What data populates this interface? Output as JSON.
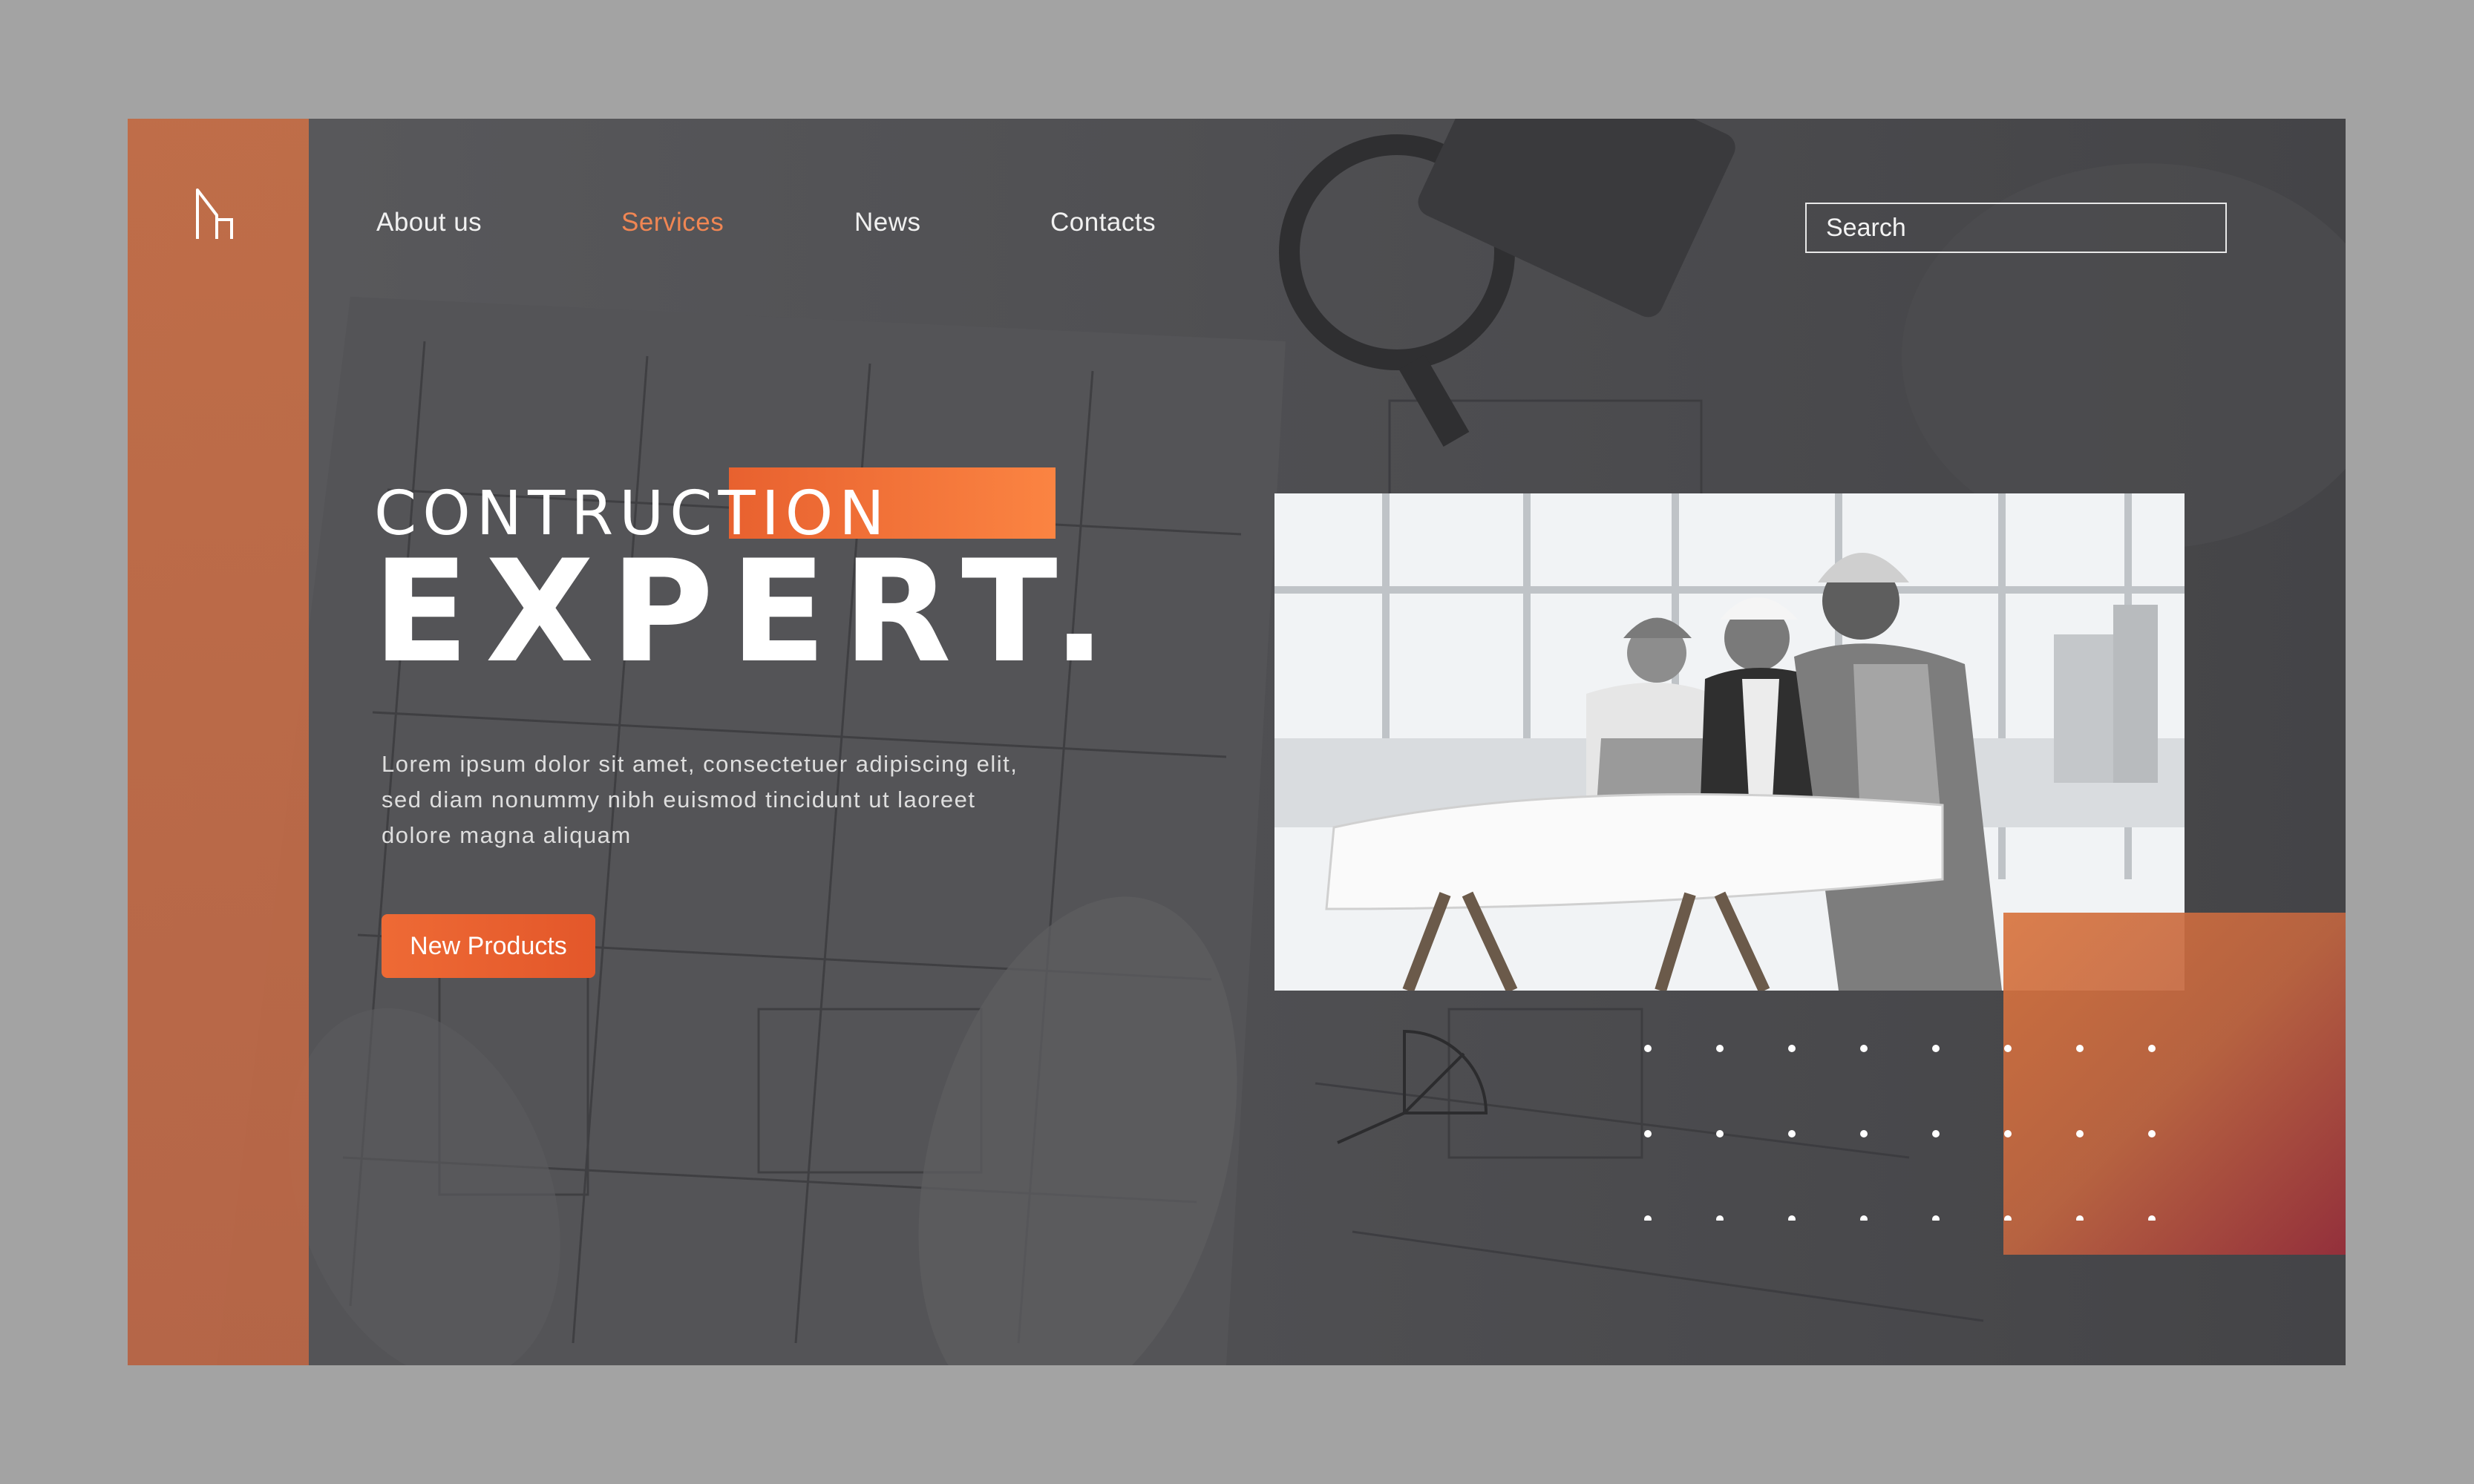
{
  "brand": {
    "logo_icon": "building-logo-icon"
  },
  "nav": {
    "items": [
      {
        "label": "About us",
        "active": false
      },
      {
        "label": "Services",
        "active": true
      },
      {
        "label": "News",
        "active": false
      },
      {
        "label": "Contacts",
        "active": false
      }
    ]
  },
  "search": {
    "placeholder": "Search"
  },
  "hero": {
    "subtitle": "CONTRUCTION",
    "title": "EXPERT.",
    "body": "Lorem ipsum dolor sit amet, consectetuer adipiscing elit, sed diam nonummy nibh euismod tincidunt ut laoreet dolore magna aliquam",
    "cta_label": "New Products"
  },
  "colors": {
    "accent": "#ee6a35",
    "background": "#48484b",
    "frame": "#a3a3a3",
    "active_nav": "#f08653"
  }
}
